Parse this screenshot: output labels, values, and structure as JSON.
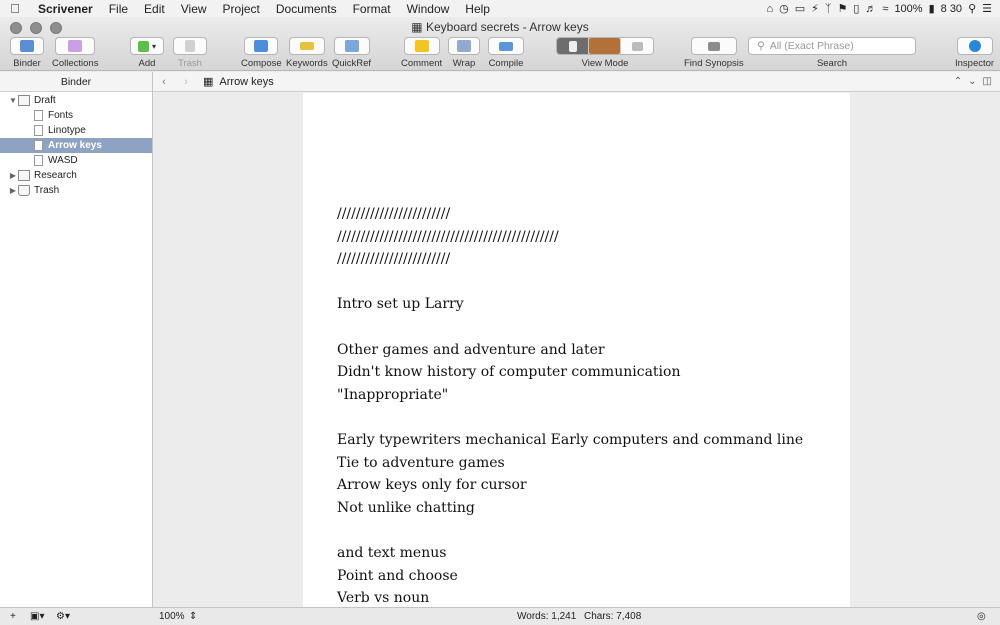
{
  "menubar": {
    "app": "Scrivener",
    "menus": [
      "File",
      "Edit",
      "View",
      "Project",
      "Documents",
      "Format",
      "Window",
      "Help"
    ],
    "battery": "100%",
    "clock": "8 30"
  },
  "window": {
    "title": "Keyboard secrets - Arrow keys"
  },
  "toolbar": {
    "binder": "Binder",
    "collections": "Collections",
    "add": "Add",
    "trash": "Trash",
    "compose": "Compose",
    "keywords": "Keywords",
    "quickref": "QuickRef",
    "comment": "Comment",
    "wrap": "Wrap",
    "compile": "Compile",
    "view_mode": "View Mode",
    "find_synopsis": "Find Synopsis",
    "search": "Search",
    "search_placeholder": "All (Exact Phrase)",
    "inspector": "Inspector"
  },
  "binder": {
    "header": "Binder",
    "items": [
      {
        "label": "Draft",
        "expanded": true
      },
      {
        "label": "Fonts"
      },
      {
        "label": "Linotype"
      },
      {
        "label": "Arrow keys",
        "selected": true
      },
      {
        "label": "WASD"
      },
      {
        "label": "Research",
        "expanded": false
      },
      {
        "label": "Trash",
        "expanded": false
      }
    ]
  },
  "editor": {
    "doc_title": "Arrow keys",
    "lines": [
      "////////////////////////",
      "///////////////////////////////////////////////",
      "////////////////////////",
      "",
      "Intro set up Larry",
      "",
      "Other games and adventure and later",
      "Didn't know history of computer communication",
      "\"Inappropriate\"",
      "",
      "Early typewriters mechanical Early computers and command line",
      "Tie to adventure games",
      "Arrow keys only for cursor",
      "Not unlike chatting",
      "",
      "and text menus",
      "Point and choose",
      "Verb vs noun"
    ]
  },
  "footer": {
    "zoom": "100%",
    "words": "Words: 1,241",
    "chars": "Chars: 7,408"
  },
  "colors": {
    "selection": "#8ea3c3",
    "add": "#5cbf4a",
    "collections": "#c9a0e6",
    "comment": "#f2c521",
    "keywords": "#e8c23a",
    "inspector": "#2a86d8"
  }
}
